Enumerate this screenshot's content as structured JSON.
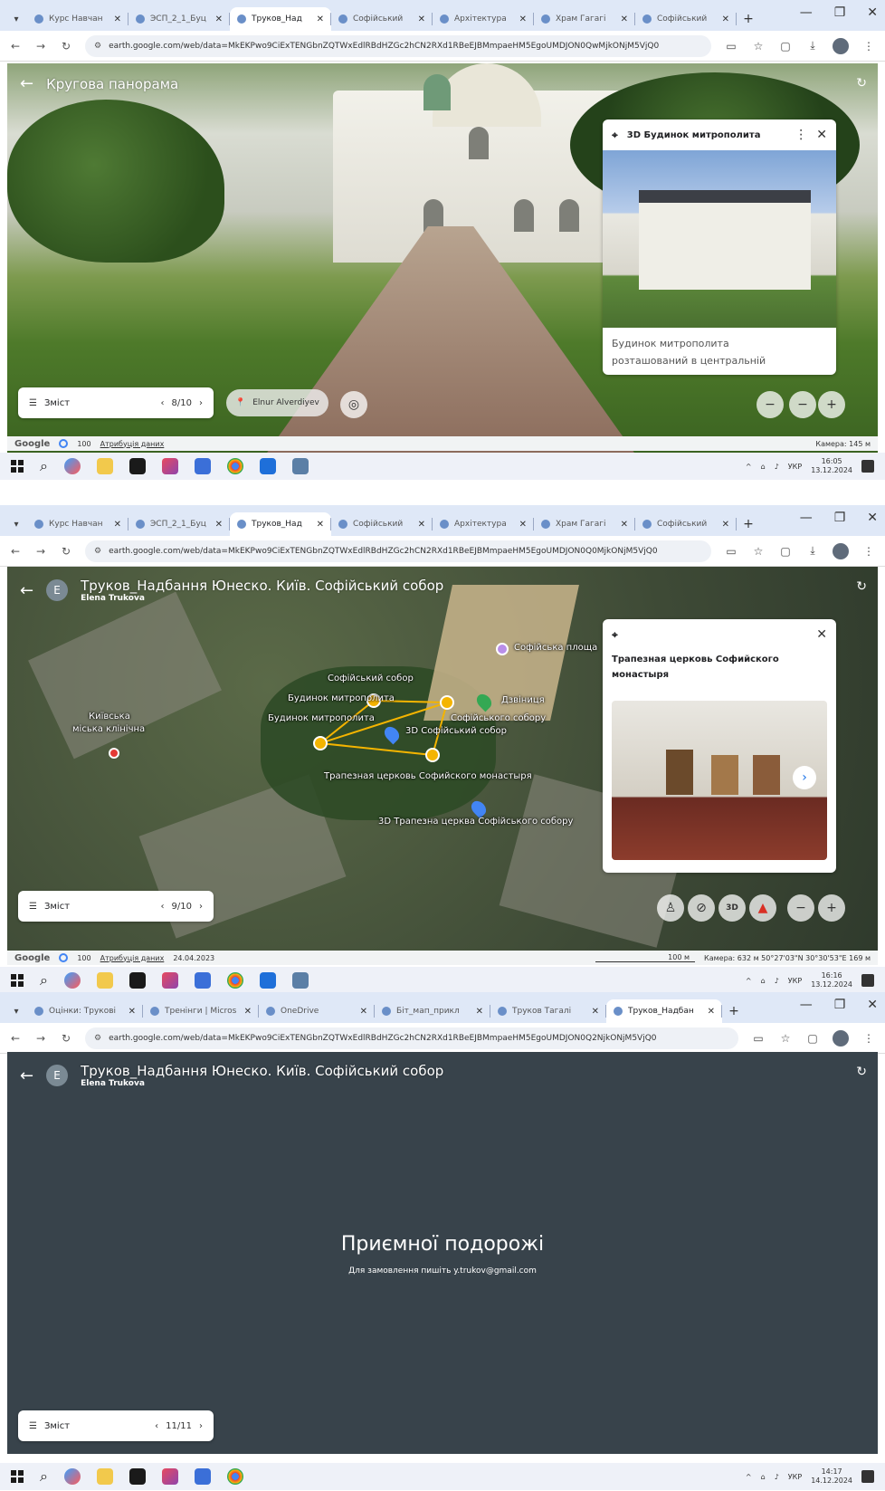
{
  "shots": [
    {
      "tabs": [
        "Курс Навчан",
        "ЭСП_2_1_Буц",
        "Труков_Над",
        "Софійський",
        "Архітектура",
        "Храм Гагагі",
        "Софійський"
      ],
      "url": "earth.google.com/web/data=MkEKPwo9CiExTENGbnZQTWxEdlRBdHZGc2hCN2RXd1RBeEJBMmpaeHM5EgoUMDJON0QwMjkONjM5VjQ0",
      "view_title": "Кругова панорама",
      "card": {
        "title": "3D Будинок митрополита",
        "desc_line1": "Будинок митрополита",
        "desc_line2": "розташований в центральній"
      },
      "toc": {
        "label": "Зміст",
        "pager": "8/10"
      },
      "chip_label": "Elnur Alverdiyev",
      "footer": {
        "brand": "Google",
        "scale": "100",
        "attr": "Атрибуція даних",
        "camera": "Камера: 145 м"
      },
      "clock": {
        "time": "16:05",
        "date": "13.12.2024"
      }
    },
    {
      "tabs": [
        "Курс Навчан",
        "ЭСП_2_1_Буц",
        "Труков_Над",
        "Софійський",
        "Архітектура",
        "Храм Гагагі",
        "Софійський"
      ],
      "url": "earth.google.com/web/data=MkEKPwo9CiExTENGbnZQTWxEdlRBdHZGc2hCN2RXd1RBeEJBMmpaeHM5EgoUMDJON0Q0MjkONjM5VjQ0",
      "view_title": "Труков_Надбання Юнеско. Київ. Софійський собор",
      "author": "Elena Trukova",
      "card": {
        "title": "Трапезная церковь Софийского монастыря"
      },
      "labels": {
        "square": "Софійська площа",
        "sofia": "Софійський собор",
        "metropolitan": "Будинок митрополита",
        "metropolitan2": "Будинок митрополита",
        "sofia3d": "3D Софійський собор",
        "sofia_b": "Софійського собору",
        "belltower": "Дзвіниця",
        "refectory": "Трапезная церковь Софийского монастыря",
        "refectory3d": "3D Трапезна церква Софійського собору",
        "kyiv": "Київська",
        "kyiv2": "міська клінічна"
      },
      "toc": {
        "label": "Зміст",
        "pager": "9/10"
      },
      "footer": {
        "brand": "Google",
        "scale": "100",
        "attr": "Атрибуція даних",
        "date": "24.04.2023",
        "scale_bar": "100 м",
        "camera": "Камера: 632 м   50°27'03\"N 30°30'53\"E   169 м"
      },
      "clock": {
        "time": "16:16",
        "date": "13.12.2024"
      }
    },
    {
      "tabs": [
        "Оцінки: Трукові",
        "Тренінги | Micros",
        "OneDrive",
        "Біт_мап_прикл",
        "Труков Тагалі",
        "Труков_Надбан"
      ],
      "url": "earth.google.com/web/data=MkEKPwo9CiExTENGbnZQTWxEdlRBdHZGc2hCN2RXd1RBeEJBMmpaeHM5EgoUMDJON0Q2NjkONjM5VjQ0",
      "view_title": "Труков_Надбання Юнеско. Київ. Софійський собор",
      "author": "Elena Trukova",
      "farewell": "Приємної подорожі",
      "contact": "Для замовлення пишіть y.trukov@gmail.com",
      "toc": {
        "label": "Зміст",
        "pager": "11/11"
      },
      "clock": {
        "time": "14:17",
        "date": "14.12.2024"
      }
    }
  ],
  "lang": "УКР"
}
